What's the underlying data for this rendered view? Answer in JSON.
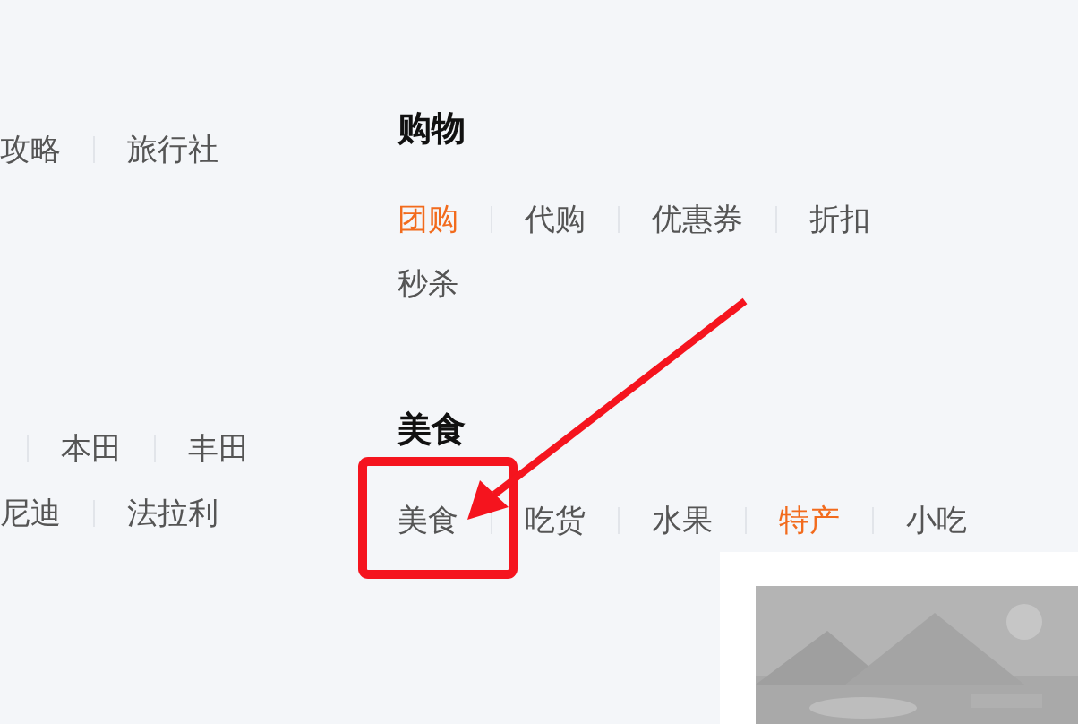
{
  "left_column": {
    "rows": [
      {
        "leading_separator": false,
        "items": [
          {
            "label": "攻略",
            "highlighted": false
          },
          {
            "label": "旅行社",
            "highlighted": false
          }
        ]
      },
      {
        "leading_separator": true,
        "items": [
          {
            "label": "本田",
            "highlighted": false
          },
          {
            "label": "丰田",
            "highlighted": false
          }
        ]
      },
      {
        "leading_separator": false,
        "items": [
          {
            "label": "尼迪",
            "highlighted": false
          },
          {
            "label": "法拉利",
            "highlighted": false
          }
        ]
      }
    ]
  },
  "sections": [
    {
      "title": "购物",
      "rows": [
        [
          {
            "label": "团购",
            "highlighted": true
          },
          {
            "label": "代购",
            "highlighted": false
          },
          {
            "label": "优惠券",
            "highlighted": false
          },
          {
            "label": "折扣",
            "highlighted": false
          }
        ],
        [
          {
            "label": "秒杀",
            "highlighted": false
          }
        ]
      ]
    },
    {
      "title": "美食",
      "rows": [
        [
          {
            "label": "美食",
            "highlighted": false
          },
          {
            "label": "吃货",
            "highlighted": false
          },
          {
            "label": "水果",
            "highlighted": false
          },
          {
            "label": "特产",
            "highlighted": true
          },
          {
            "label": "小吃",
            "highlighted": false
          }
        ]
      ]
    }
  ]
}
